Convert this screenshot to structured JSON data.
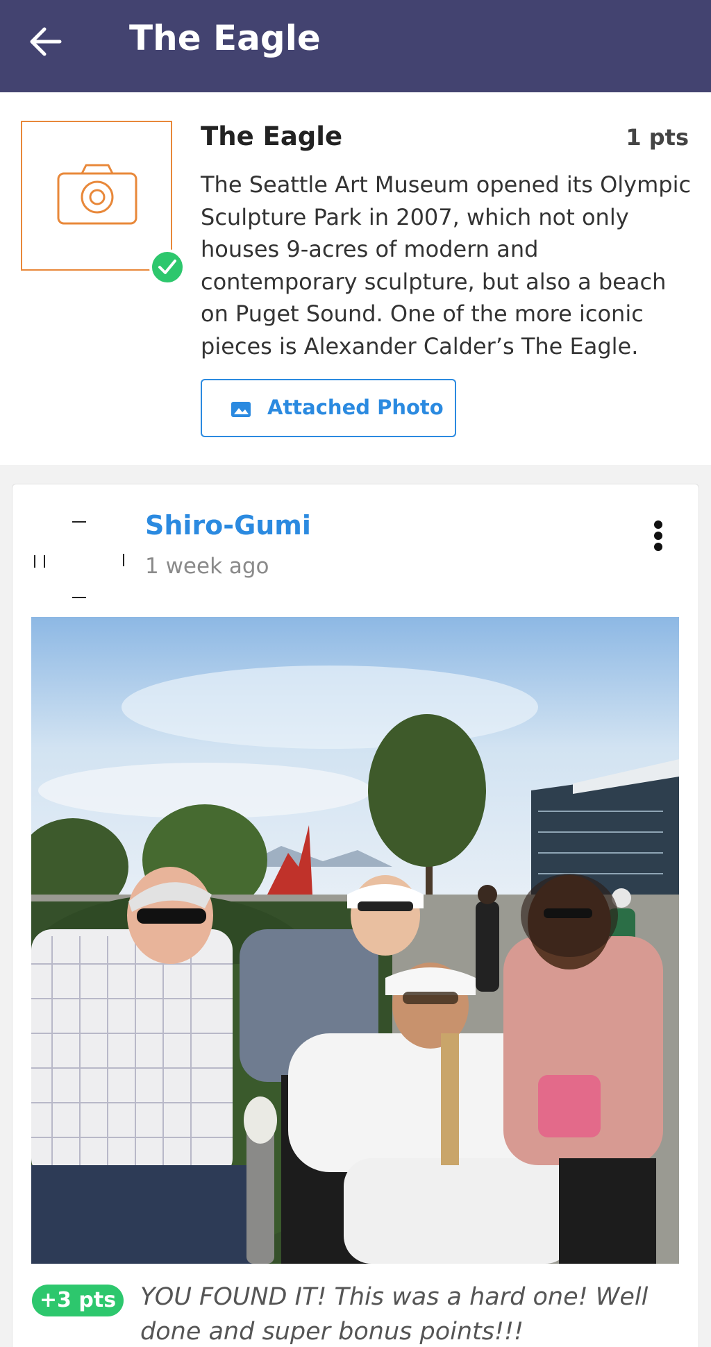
{
  "header": {
    "title": "The Eagle",
    "back_icon": "arrow-left-icon",
    "background": "#434370"
  },
  "mission": {
    "title": "The Eagle",
    "points": "1 pts",
    "description": "The Seattle Art Museum opened its Olympic Sculpture Park in 2007, which not only houses 9-acres of modern and contemporary sculpture, but also a beach on Puget Sound. One of the more iconic pieces is Alexander Calder’s The Eagle.",
    "thumbnail_icon": "camera-icon",
    "completed_icon": "check-icon",
    "attached_photo_label": "Attached Photo",
    "attached_photo_icon": "image-icon",
    "accent": "#2b8ae0",
    "thumbnail_color": "#e8883a",
    "success_color": "#2dc76d"
  },
  "post": {
    "username": "Shiro-Gumi",
    "time": "1 week ago",
    "menu_icon": "more-vertical-icon",
    "photo": "group-photo-at-sculpture-park",
    "points_badge": "+3 pts",
    "comment": "YOU FOUND IT! This was a hard one! Well done and super bonus points!!!"
  }
}
